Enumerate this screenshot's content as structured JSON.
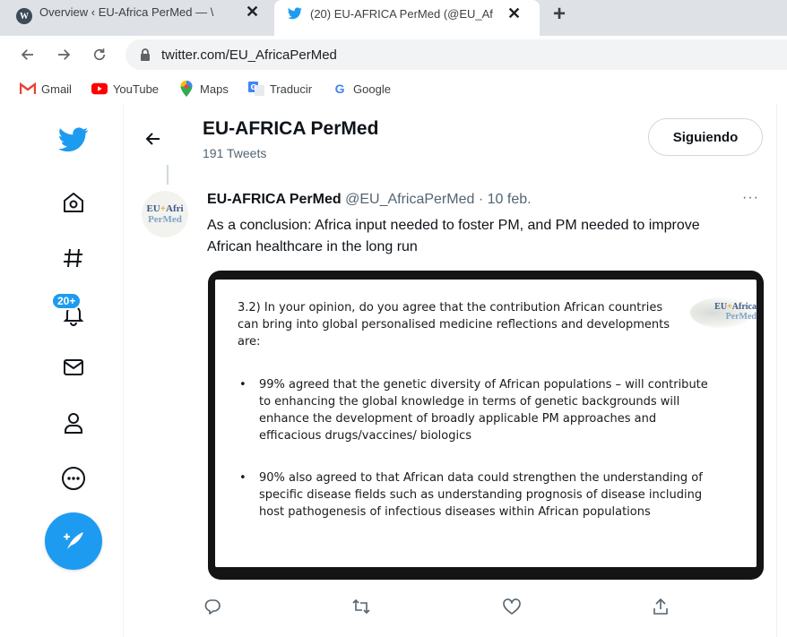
{
  "browser": {
    "tabs": [
      {
        "title": "Overview ‹ EU-Africa PerMed — \\",
        "icon": "wordpress-icon",
        "active": false
      },
      {
        "title": "(20) EU-AFRICA PerMed (@EU_Af",
        "icon": "twitter-icon",
        "active": true
      }
    ],
    "tab_close_glyph": "✕",
    "new_tab_glyph": "+",
    "url": "twitter.com/EU_AfricaPerMed",
    "bookmarks": [
      {
        "label": "Gmail",
        "icon": "gmail-icon"
      },
      {
        "label": "YouTube",
        "icon": "youtube-icon"
      },
      {
        "label": "Maps",
        "icon": "maps-icon"
      },
      {
        "label": "Traducir",
        "icon": "translate-icon"
      },
      {
        "label": "Google",
        "icon": "google-icon"
      }
    ]
  },
  "colors": {
    "twitter_blue": "#1d9bf0",
    "text_primary": "#0f1419",
    "text_secondary": "#536471"
  },
  "sidebar": {
    "items": [
      {
        "name": "twitter-logo-icon"
      },
      {
        "name": "home-icon"
      },
      {
        "name": "explore-hashtag-icon"
      },
      {
        "name": "notifications-bell-icon"
      },
      {
        "name": "messages-envelope-icon"
      },
      {
        "name": "profile-person-icon"
      },
      {
        "name": "more-circle-icon"
      }
    ],
    "notification_badge": "20+",
    "compose_icon": "compose-feather-icon"
  },
  "header": {
    "name": "EU-AFRICA PerMed",
    "tweet_count": "191 Tweets",
    "follow_button": "Siguiendo"
  },
  "tweet": {
    "avatar_line1_a": "EU",
    "avatar_line1_plus": "+",
    "avatar_line1_b": "Afri",
    "avatar_line2": "PerMed",
    "author_name": "EU-AFRICA PerMed",
    "author_handle": "@EU_AfricaPerMed",
    "separator": "·",
    "date": "10 feb.",
    "more_label": "···",
    "text": "As a conclusion: Africa input needed to foster PM, and PM needed to improve African healthcare in the long run",
    "image": {
      "question": "3.2) In your opinion, do you agree that the contribution African countries can bring into global personalised medicine reflections and developments are:",
      "bullet1": "99% agreed that the genetic diversity of African populations – will contribute to enhancing the global knowledge in terms of genetic backgrounds will enhance the development of broadly applicable PM approaches and efficacious drugs/vaccines/ biologics",
      "bullet2": "90% also agreed to that African data could strengthen the understanding of specific disease fields such as understanding prognosis of disease including host pathogenesis of infectious diseases within African populations",
      "logo_line1_a": "EU",
      "logo_line1_plus": "+",
      "logo_line1_b": "Africa",
      "logo_line2": "PerMed"
    },
    "actions": [
      {
        "name": "reply-icon"
      },
      {
        "name": "retweet-icon"
      },
      {
        "name": "like-heart-icon"
      },
      {
        "name": "share-icon"
      }
    ]
  }
}
